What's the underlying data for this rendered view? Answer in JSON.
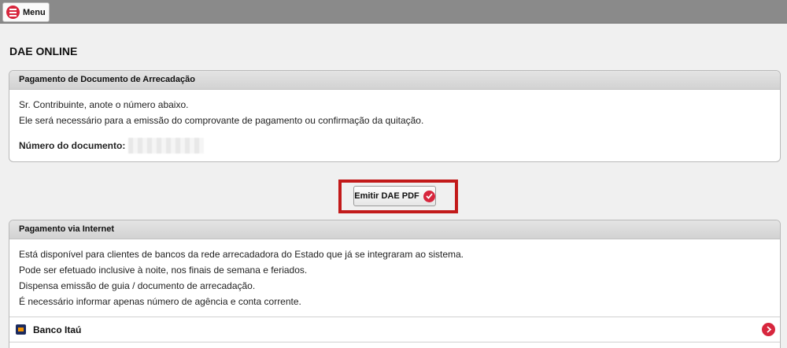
{
  "topbar": {
    "menu_label": "Menu"
  },
  "page": {
    "title": "DAE ONLINE"
  },
  "payment_doc_panel": {
    "header": "Pagamento de Documento de Arrecadação",
    "line1": "Sr. Contribuinte, anote o número abaixo.",
    "line2": "Ele será necessário para a emissão do comprovante de pagamento ou confirmação da quitação.",
    "doc_number_label": "Número do documento:"
  },
  "emit_button": {
    "label": "Emitir DAE PDF"
  },
  "internet_panel": {
    "header": "Pagamento via Internet",
    "lines": [
      "Está disponível para clientes de bancos da rede arrecadadora do Estado que já se integraram ao sistema.",
      "Pode ser efetuado inclusive à noite, nos finais de semana e feriados.",
      "Dispensa emissão de guia / documento de arrecadação.",
      "É necessário informar apenas número de agência e conta corrente."
    ],
    "banks": [
      {
        "name": "Banco Itaú",
        "icon": "itau-logo-icon"
      }
    ]
  },
  "colors": {
    "accent": "#d7263d",
    "highlight_frame": "#c21a1a",
    "topbar": "#8a8a8a"
  }
}
